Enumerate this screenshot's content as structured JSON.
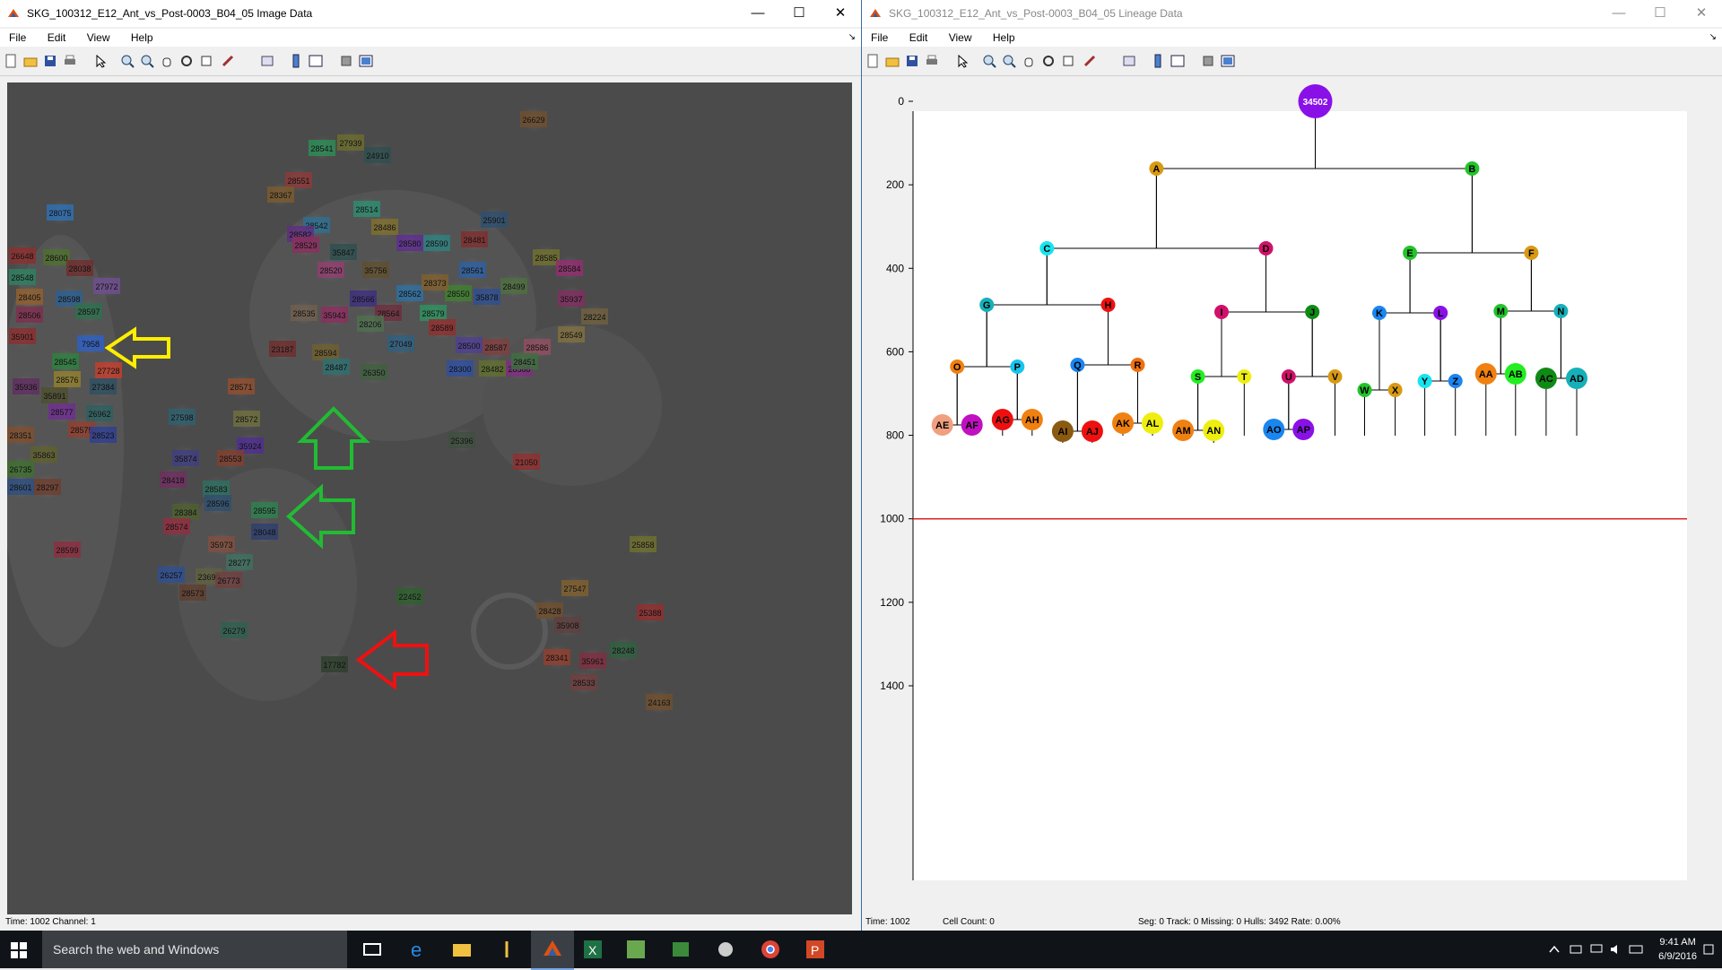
{
  "left_window": {
    "title": "SKG_100312_E12_Ant_vs_Post-0003_B04_05 Image Data",
    "menu": [
      "File",
      "Edit",
      "View",
      "Help"
    ],
    "status": "Time: 1002  Channel: 1",
    "cell_labels": [
      {
        "text": "28541",
        "color": "#2e8b57"
      },
      {
        "text": "27939",
        "color": "#6b6b2f"
      },
      {
        "text": "24910",
        "color": "#2f4f4f"
      },
      {
        "text": "28551",
        "color": "#8b3a3a"
      },
      {
        "text": "28367",
        "color": "#7a5a2f"
      },
      {
        "text": "28542",
        "color": "#2f6f8f"
      },
      {
        "text": "28582",
        "color": "#5f2f7f"
      },
      {
        "text": "28529",
        "color": "#8b2f5f"
      },
      {
        "text": "28514",
        "color": "#2f8b6f"
      },
      {
        "text": "28486",
        "color": "#7f6f2f"
      },
      {
        "text": "25901",
        "color": "#2f4f6f"
      },
      {
        "text": "28075",
        "color": "#2f6faf"
      },
      {
        "text": "26648",
        "color": "#8b2f2f"
      },
      {
        "text": "28600",
        "color": "#4f6f2f"
      },
      {
        "text": "28038",
        "color": "#6f2f2f"
      },
      {
        "text": "28548",
        "color": "#2f7f5f"
      },
      {
        "text": "27972",
        "color": "#6f4f8f"
      },
      {
        "text": "28405",
        "color": "#8f5f2f"
      },
      {
        "text": "28598",
        "color": "#2f5f8f"
      },
      {
        "text": "28506",
        "color": "#7f2f4f"
      },
      {
        "text": "28597",
        "color": "#2f6f4f"
      },
      {
        "text": "35901",
        "color": "#8b2f2f"
      },
      {
        "text": "7958",
        "color": "#2f5fbf"
      },
      {
        "text": "28545",
        "color": "#2f7f3f"
      },
      {
        "text": "27728",
        "color": "#bf3f2f"
      },
      {
        "text": "28576",
        "color": "#8f7f2f"
      },
      {
        "text": "27384",
        "color": "#2f4f5f"
      },
      {
        "text": "35936",
        "color": "#5f2f5f"
      },
      {
        "text": "35891",
        "color": "#4f4f2f"
      },
      {
        "text": "28577",
        "color": "#6f2f8f"
      },
      {
        "text": "26962",
        "color": "#2f5f5f"
      },
      {
        "text": "28575",
        "color": "#8f3f2f"
      },
      {
        "text": "28523",
        "color": "#2f3f8f"
      },
      {
        "text": "28351",
        "color": "#7f4f2f"
      },
      {
        "text": "35863",
        "color": "#5f5f2f"
      },
      {
        "text": "26735",
        "color": "#3f6f2f"
      },
      {
        "text": "28601",
        "color": "#2f4f7f"
      },
      {
        "text": "28297",
        "color": "#6f3f2f"
      },
      {
        "text": "28599",
        "color": "#8b2f3f"
      },
      {
        "text": "26629",
        "color": "#6f4f2f"
      },
      {
        "text": "28580",
        "color": "#5f2f8f"
      },
      {
        "text": "28590",
        "color": "#2f7f7f"
      },
      {
        "text": "28481",
        "color": "#7f2f2f"
      },
      {
        "text": "28561",
        "color": "#2f5f9f"
      },
      {
        "text": "28585",
        "color": "#6f6f2f"
      },
      {
        "text": "28584",
        "color": "#8f2f6f"
      },
      {
        "text": "28499",
        "color": "#4f6f3f"
      },
      {
        "text": "35937",
        "color": "#7f2f5f"
      },
      {
        "text": "28550",
        "color": "#3f7f2f"
      },
      {
        "text": "35878",
        "color": "#2f4f8f"
      },
      {
        "text": "28224",
        "color": "#6f5f3f"
      },
      {
        "text": "28520",
        "color": "#8f3f6f"
      },
      {
        "text": "35756",
        "color": "#5f4f2f"
      },
      {
        "text": "28562",
        "color": "#2f6f9f"
      },
      {
        "text": "28373",
        "color": "#7f5f2f"
      },
      {
        "text": "28566",
        "color": "#3f2f7f"
      },
      {
        "text": "28564",
        "color": "#6f2f3f"
      },
      {
        "text": "28579",
        "color": "#2f8f5f"
      },
      {
        "text": "28589",
        "color": "#8f2f2f"
      },
      {
        "text": "28549",
        "color": "#7f6f3f"
      },
      {
        "text": "23187",
        "color": "#6f2f2f"
      },
      {
        "text": "27049",
        "color": "#2f5f7f"
      },
      {
        "text": "28500",
        "color": "#4f3f8f"
      },
      {
        "text": "28587",
        "color": "#7f3f3f"
      },
      {
        "text": "28586",
        "color": "#8f4f5f"
      },
      {
        "text": "28594",
        "color": "#6f5f2f"
      },
      {
        "text": "28487",
        "color": "#2f6f6f"
      },
      {
        "text": "26350",
        "color": "#3f5f3f"
      },
      {
        "text": "28300",
        "color": "#2f4f9f"
      },
      {
        "text": "28482",
        "color": "#5f6f2f"
      },
      {
        "text": "28588",
        "color": "#7f2f7f"
      },
      {
        "text": "28451",
        "color": "#3f6f3f"
      },
      {
        "text": "28571",
        "color": "#8f4f2f"
      },
      {
        "text": "27598",
        "color": "#2f5f6f"
      },
      {
        "text": "28572",
        "color": "#6f6f3f"
      },
      {
        "text": "35924",
        "color": "#4f2f8f"
      },
      {
        "text": "28553",
        "color": "#7f3f2f"
      },
      {
        "text": "28418",
        "color": "#6f2f5f"
      },
      {
        "text": "28583",
        "color": "#2f6f5f"
      },
      {
        "text": "28596",
        "color": "#2f4f6f"
      },
      {
        "text": "28384",
        "color": "#4f5f2f"
      },
      {
        "text": "28595",
        "color": "#2f7f4f"
      },
      {
        "text": "28048",
        "color": "#2f3f6f"
      },
      {
        "text": "28574",
        "color": "#8f2f3f"
      },
      {
        "text": "35973",
        "color": "#7f4f3f"
      },
      {
        "text": "28277",
        "color": "#3f6f5f"
      },
      {
        "text": "26257",
        "color": "#2f4f8f"
      },
      {
        "text": "23699",
        "color": "#5f5f3f"
      },
      {
        "text": "26773",
        "color": "#6f3f3f"
      },
      {
        "text": "28573",
        "color": "#5f3f2f"
      },
      {
        "text": "26279",
        "color": "#2f5f4f"
      },
      {
        "text": "25396",
        "color": "#3f4f3f"
      },
      {
        "text": "21050",
        "color": "#8f2f2f"
      },
      {
        "text": "25858",
        "color": "#6f6f2f"
      },
      {
        "text": "22452",
        "color": "#2f5f2f"
      },
      {
        "text": "27547",
        "color": "#7f5f2f"
      },
      {
        "text": "28428",
        "color": "#6f4f2f"
      },
      {
        "text": "35908",
        "color": "#5f3f3f"
      },
      {
        "text": "25388",
        "color": "#8f2f2f"
      },
      {
        "text": "28248",
        "color": "#2f5f3f"
      },
      {
        "text": "28341",
        "color": "#8f3f2f"
      },
      {
        "text": "35961",
        "color": "#7f2f3f"
      },
      {
        "text": "28533",
        "color": "#6f3f3f"
      },
      {
        "text": "24163",
        "color": "#6f4f2f"
      },
      {
        "text": "17782",
        "color": "#2f3f2f"
      },
      {
        "text": "35943",
        "color": "#8b2f5f"
      },
      {
        "text": "35847",
        "color": "#2f4f4f"
      },
      {
        "text": "35874",
        "color": "#3f3f7f"
      },
      {
        "text": "28535",
        "color": "#6f5f4f"
      },
      {
        "text": "28206",
        "color": "#4f6f4f"
      }
    ],
    "arrows": [
      {
        "color": "#ffee00",
        "direction": "left"
      },
      {
        "color": "#22bb33",
        "direction": "up"
      },
      {
        "color": "#22bb33",
        "direction": "left"
      },
      {
        "color": "#ee1111",
        "direction": "left"
      }
    ]
  },
  "right_window": {
    "title": "SKG_100312_E12_Ant_vs_Post-0003_B04_05 Lineage Data",
    "menu": [
      "File",
      "Edit",
      "View",
      "Help"
    ],
    "status_time": "Time: 1002",
    "status_count": "Cell Count: 0",
    "status_stats": "Seg: 0 Track: 0 Missing: 0 Hulls: 3492 Rate: 0.00%",
    "red_line_time": 1000,
    "y_ticks": [
      "0",
      "200",
      "400",
      "600",
      "800",
      "1000",
      "1200",
      "1400"
    ],
    "root": {
      "label": "34502",
      "color": "#8a10e8"
    },
    "nodes": [
      {
        "label": "A",
        "color": "#d89a14"
      },
      {
        "label": "B",
        "color": "#22c42a"
      },
      {
        "label": "C",
        "color": "#18e4ee"
      },
      {
        "label": "D",
        "color": "#d0106a"
      },
      {
        "label": "E",
        "color": "#22c42a"
      },
      {
        "label": "F",
        "color": "#d89a14"
      },
      {
        "label": "G",
        "color": "#16b0b8"
      },
      {
        "label": "H",
        "color": "#ee1010"
      },
      {
        "label": "I",
        "color": "#d0106a"
      },
      {
        "label": "J",
        "color": "#108a14"
      },
      {
        "label": "K",
        "color": "#1a86f0"
      },
      {
        "label": "L",
        "color": "#8a10e8"
      },
      {
        "label": "M",
        "color": "#22c42a"
      },
      {
        "label": "N",
        "color": "#16b0b8"
      },
      {
        "label": "O",
        "color": "#f08010"
      },
      {
        "label": "P",
        "color": "#18c4ee"
      },
      {
        "label": "Q",
        "color": "#1a86f0"
      },
      {
        "label": "R",
        "color": "#f07010"
      },
      {
        "label": "S",
        "color": "#22ee22"
      },
      {
        "label": "T",
        "color": "#eeee10"
      },
      {
        "label": "U",
        "color": "#d0106a"
      },
      {
        "label": "V",
        "color": "#d89a14"
      },
      {
        "label": "W",
        "color": "#22c42a"
      },
      {
        "label": "X",
        "color": "#d89a14"
      },
      {
        "label": "Y",
        "color": "#18e4ee"
      },
      {
        "label": "Z",
        "color": "#1a86f0"
      },
      {
        "label": "AA",
        "color": "#f08010"
      },
      {
        "label": "AB",
        "color": "#22ee22"
      },
      {
        "label": "AC",
        "color": "#108a14"
      },
      {
        "label": "AD",
        "color": "#16b0b8"
      },
      {
        "label": "AE",
        "color": "#f0a080"
      },
      {
        "label": "AF",
        "color": "#c010c0"
      },
      {
        "label": "AG",
        "color": "#ee1010"
      },
      {
        "label": "AH",
        "color": "#f08010"
      },
      {
        "label": "AI",
        "color": "#8a5a10"
      },
      {
        "label": "AJ",
        "color": "#ee1010"
      },
      {
        "label": "AK",
        "color": "#f08010"
      },
      {
        "label": "AL",
        "color": "#eeee10"
      },
      {
        "label": "AM",
        "color": "#f08010"
      },
      {
        "label": "AN",
        "color": "#eeee10"
      },
      {
        "label": "AO",
        "color": "#1a86f0"
      },
      {
        "label": "AP",
        "color": "#8a10e8"
      }
    ]
  },
  "taskbar": {
    "search_placeholder": "Search the web and Windows",
    "time": "9:41 AM",
    "date": "6/9/2016"
  }
}
